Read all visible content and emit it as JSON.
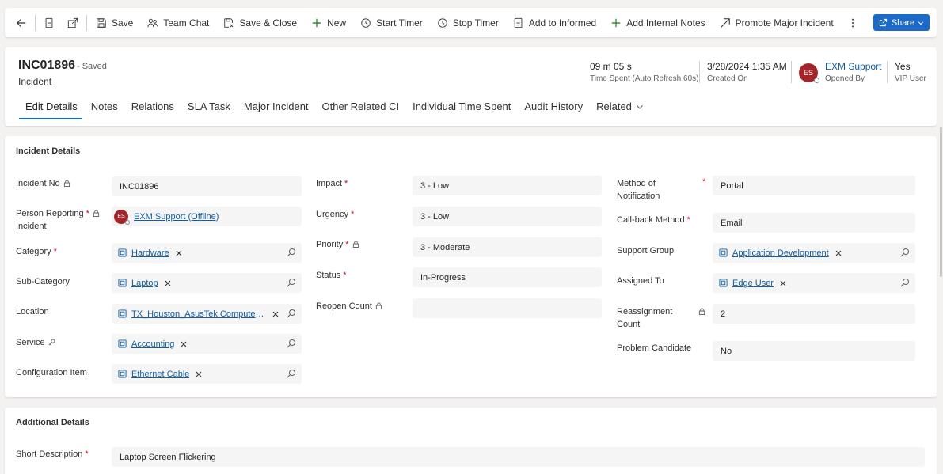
{
  "toolbar": {
    "save": "Save",
    "team_chat": "Team Chat",
    "save_close": "Save & Close",
    "new": "New",
    "start_timer": "Start Timer",
    "stop_timer": "Stop Timer",
    "add_informed": "Add to Informed",
    "add_notes": "Add Internal Notes",
    "promote": "Promote Major Incident",
    "share": "Share"
  },
  "header": {
    "record_id": "INC01896",
    "saved_status": "- Saved",
    "entity": "Incident",
    "time_spent_value": "09 m 05 s",
    "time_spent_label": "Time Spent (Auto Refresh 60s)",
    "created_on_value": "3/28/2024 1:35 AM",
    "created_on_label": "Created On",
    "opened_by_initials": "ES",
    "opened_by_value": "EXM Support",
    "opened_by_label": "Opened By",
    "vip_value": "Yes",
    "vip_label": "VIP User"
  },
  "tabs": [
    {
      "label": "Edit Details"
    },
    {
      "label": "Notes"
    },
    {
      "label": "Relations"
    },
    {
      "label": "SLA Task"
    },
    {
      "label": "Major Incident"
    },
    {
      "label": "Other Related CI"
    },
    {
      "label": "Individual Time Spent"
    },
    {
      "label": "Audit History"
    },
    {
      "label": "Related"
    }
  ],
  "incident_details": {
    "title": "Incident Details",
    "incident_no": {
      "label": "Incident No",
      "value": "INC01896"
    },
    "person_reporting": {
      "label": "Person Reporting",
      "label2": "Incident",
      "initials": "ES",
      "value": "EXM Support (Offline)"
    },
    "category": {
      "label": "Category",
      "value": "Hardware"
    },
    "sub_category": {
      "label": "Sub-Category",
      "value": "Laptop"
    },
    "location": {
      "label": "Location",
      "value": "TX_Houston_AsusTek Computer ..."
    },
    "service": {
      "label": "Service",
      "value": "Accounting"
    },
    "configuration_item": {
      "label": "Configuration Item",
      "value": "Ethernet Cable"
    },
    "impact": {
      "label": "Impact",
      "value": "3 - Low"
    },
    "urgency": {
      "label": "Urgency",
      "value": "3 - Low"
    },
    "priority": {
      "label": "Priority",
      "value": "3 - Moderate"
    },
    "status": {
      "label": "Status",
      "value": "In-Progress"
    },
    "reopen_count": {
      "label": "Reopen Count",
      "value": ""
    },
    "method_of_notification": {
      "label": "Method of",
      "label2": "Notification",
      "value": "Portal"
    },
    "callback_method": {
      "label": "Call-back Method",
      "value": "Email"
    },
    "support_group": {
      "label": "Support Group",
      "value": "Application Development"
    },
    "assigned_to": {
      "label": "Assigned To",
      "value": "Edge User"
    },
    "reassignment_count": {
      "label": "Reassignment",
      "label2": "Count",
      "value": "2"
    },
    "problem_candidate": {
      "label": "Problem Candidate",
      "value": "No"
    }
  },
  "additional_details": {
    "title": "Additional Details",
    "short_description": {
      "label": "Short Description",
      "value": "Laptop Screen Flickering"
    }
  }
}
